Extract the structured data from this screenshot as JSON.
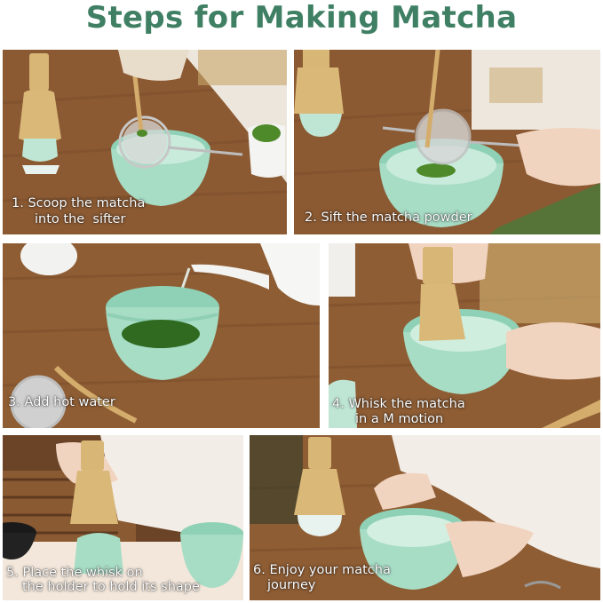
{
  "title": "Steps for Making Matcha",
  "steps": [
    {
      "line1": "1. Scoop the matcha",
      "line2": "into the  sifter"
    },
    {
      "line1": "2. Sift the matcha powder",
      "line2": ""
    },
    {
      "line1": "3. Add hot water",
      "line2": ""
    },
    {
      "line1": "4. Whisk the matcha",
      "line2": "in a M motion"
    },
    {
      "line1": "5. Place the whisk on",
      "line2": "the holder to hold its shape"
    },
    {
      "line1": "6. Enjoy your matcha",
      "line2": "journey"
    }
  ],
  "colors": {
    "title": "#3f7f63",
    "bowl": "#a7dcc5",
    "matcha": "#4f8a2a",
    "wood": "#8a5a32",
    "bamboo": "#d9b878"
  }
}
